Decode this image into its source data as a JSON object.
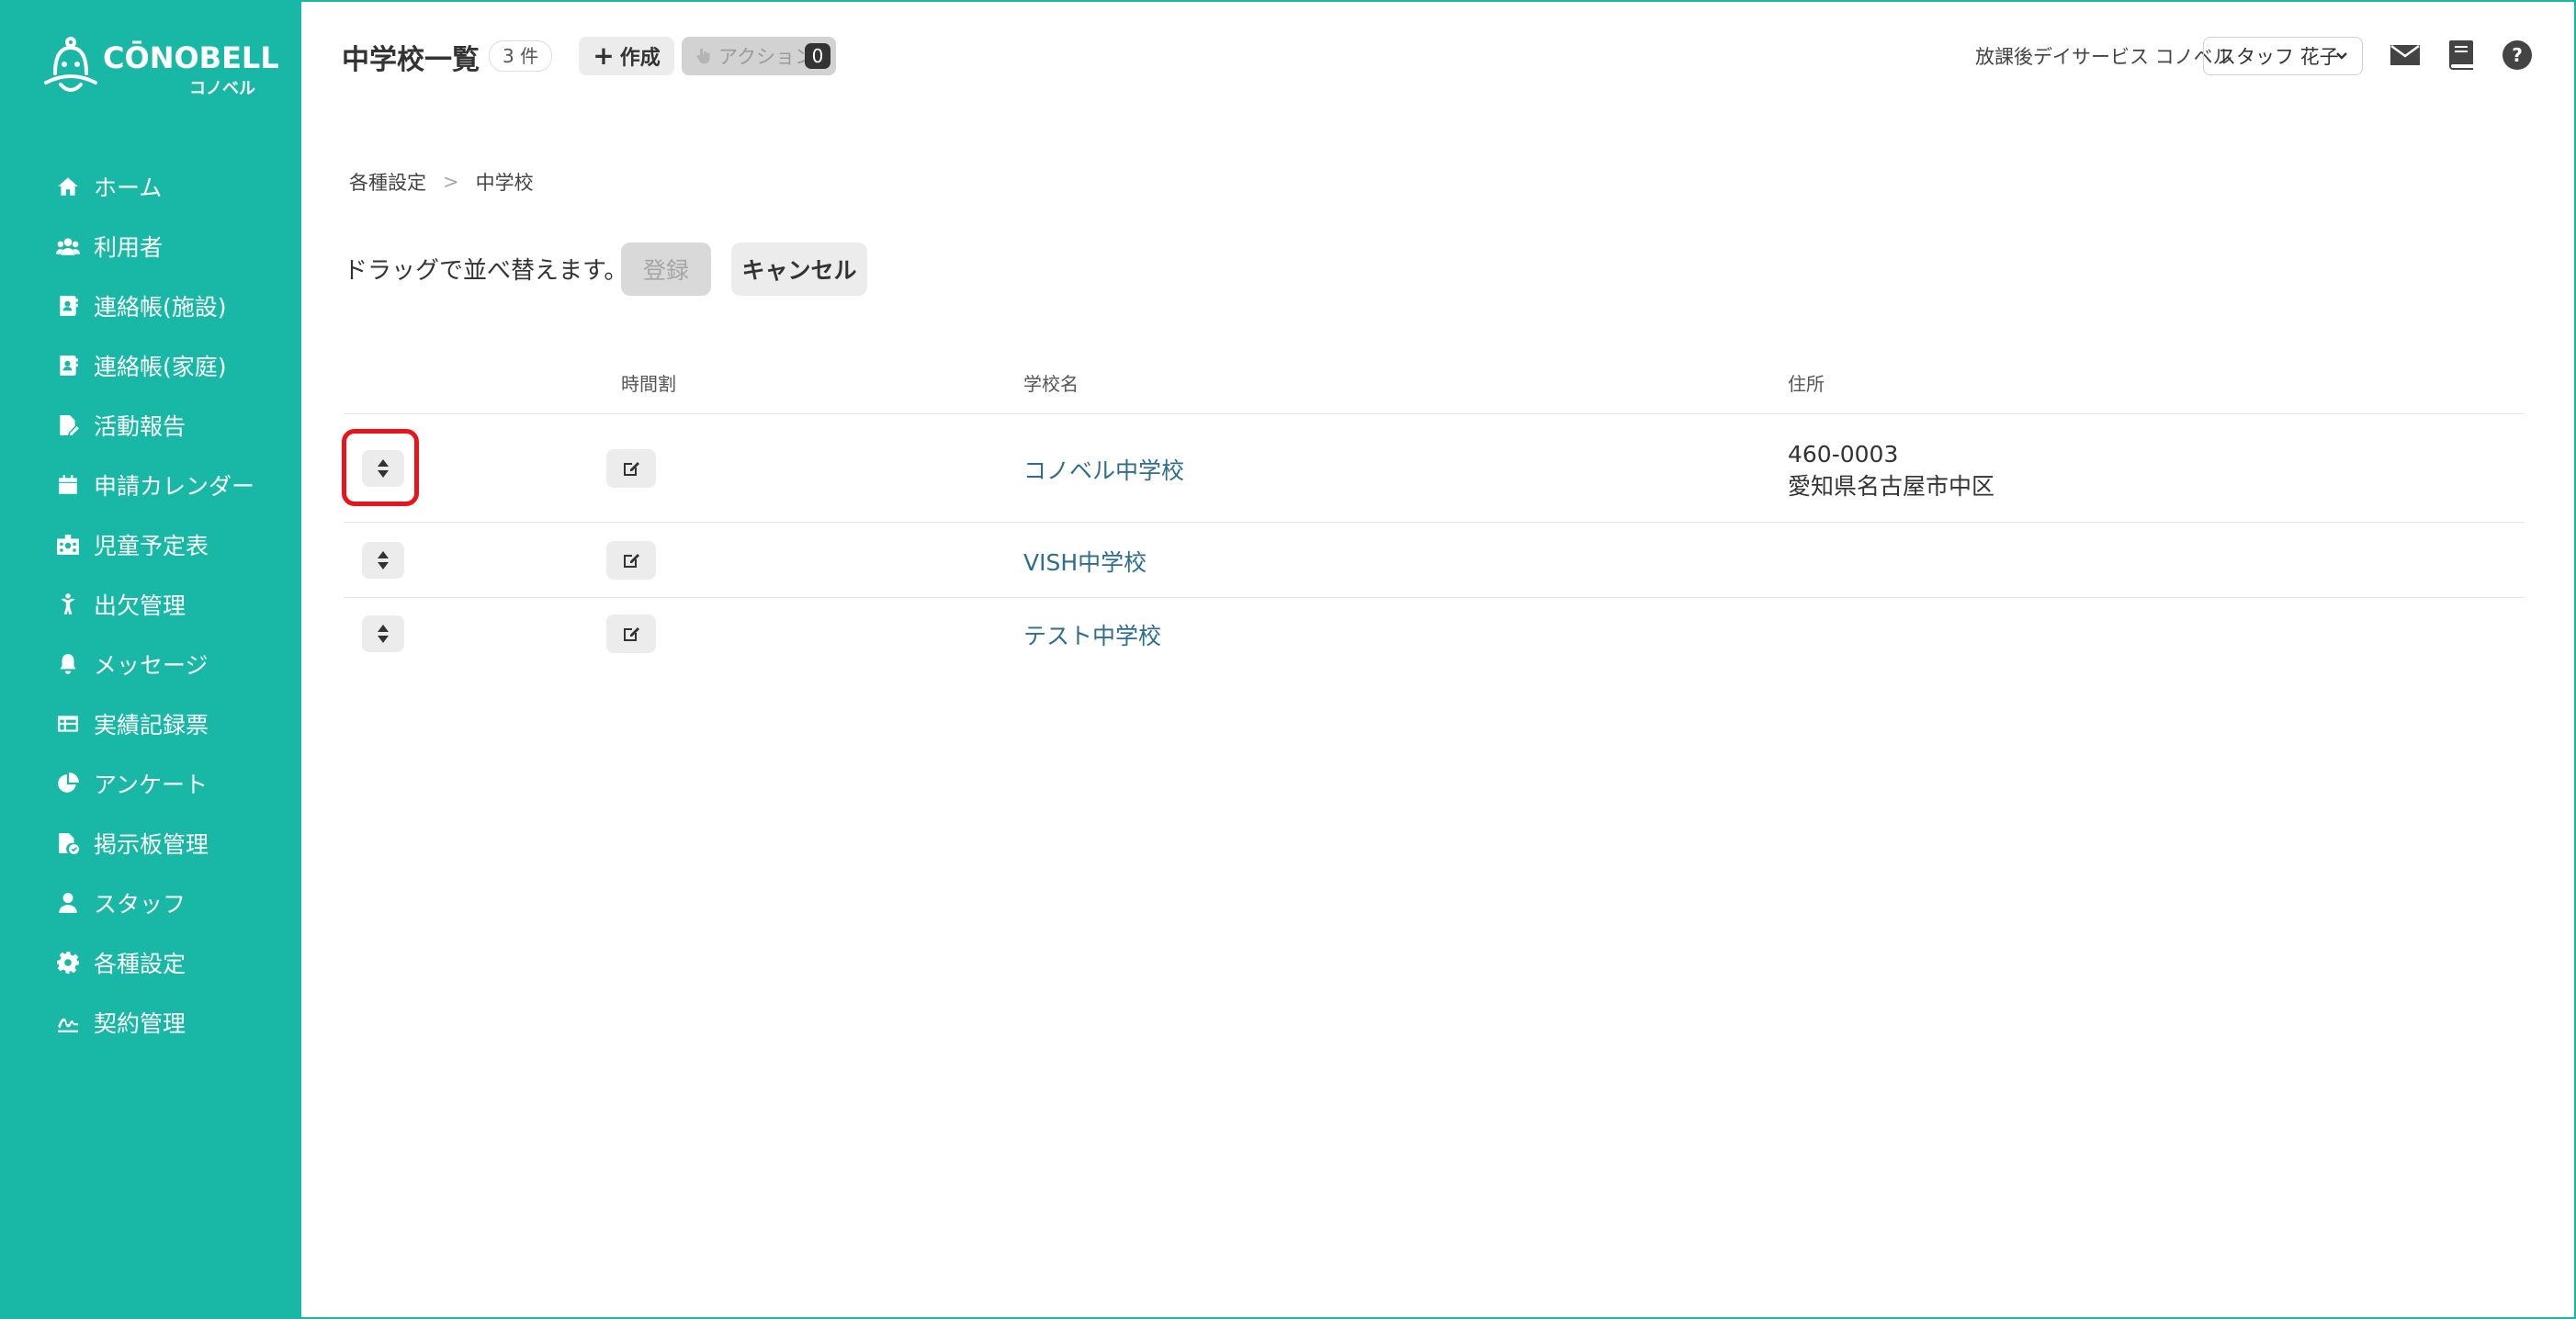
{
  "brand": {
    "logo_text": "CŌNOBELL",
    "logo_sub": "コノベル"
  },
  "sidebar": {
    "items": [
      {
        "label": "ホーム",
        "icon": "home-icon"
      },
      {
        "label": "利用者",
        "icon": "users-icon"
      },
      {
        "label": "連絡帳(施設)",
        "icon": "contact-book-icon"
      },
      {
        "label": "連絡帳(家庭)",
        "icon": "contact-book-icon"
      },
      {
        "label": "活動報告",
        "icon": "report-icon"
      },
      {
        "label": "申請カレンダー",
        "icon": "calendar-icon"
      },
      {
        "label": "児童予定表",
        "icon": "schedule-icon"
      },
      {
        "label": "出欠管理",
        "icon": "attendance-icon"
      },
      {
        "label": "メッセージ",
        "icon": "bell-icon"
      },
      {
        "label": "実績記録票",
        "icon": "table-icon"
      },
      {
        "label": "アンケート",
        "icon": "pie-chart-icon"
      },
      {
        "label": "掲示板管理",
        "icon": "bulletin-icon"
      },
      {
        "label": "スタッフ",
        "icon": "staff-icon"
      },
      {
        "label": "各種設定",
        "icon": "gear-icon"
      },
      {
        "label": "契約管理",
        "icon": "contract-icon"
      }
    ]
  },
  "header": {
    "title": "中学校一覧",
    "count": "3 件",
    "create_label": "作成",
    "action_label": "アクション",
    "action_count": "0",
    "facility": "放課後デイサービス コノベル",
    "staff": "スタッフ 花子"
  },
  "breadcrumb": {
    "parent": "各種設定",
    "separator": ">",
    "current": "中学校"
  },
  "toolbar": {
    "hint": "ドラッグで並べ替えます。",
    "register_label": "登録",
    "cancel_label": "キャンセル"
  },
  "table": {
    "headers": {
      "timetable": "時間割",
      "school_name": "学校名",
      "address": "住所"
    },
    "rows": [
      {
        "name": "コノベル中学校",
        "postal": "460-0003",
        "address": "愛知県名古屋市中区"
      },
      {
        "name": "VISH中学校",
        "postal": "",
        "address": ""
      },
      {
        "name": "テスト中学校",
        "postal": "",
        "address": ""
      }
    ]
  },
  "colors": {
    "primary": "#18b7a6",
    "link": "#2d6e8e",
    "highlight": "#e8141b"
  }
}
